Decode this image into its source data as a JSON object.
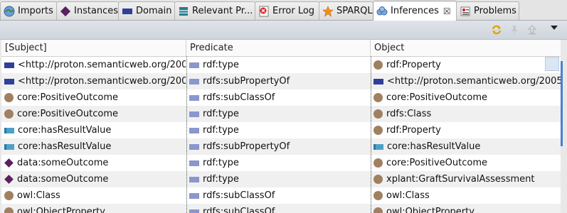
{
  "tabs": [
    {
      "label": "Imports",
      "icon": "imports-icon",
      "active": false
    },
    {
      "label": "Instances",
      "icon": "instances-icon",
      "active": false
    },
    {
      "label": "Domain",
      "icon": "domain-icon",
      "active": false
    },
    {
      "label": "Relevant Pr...",
      "icon": "relevant-properties-icon",
      "active": false
    },
    {
      "label": "Error Log",
      "icon": "error-log-icon",
      "active": false
    },
    {
      "label": "SPARQL",
      "icon": "sparql-icon",
      "active": false
    },
    {
      "label": "Inferences",
      "icon": "inferences-icon",
      "active": true,
      "close": "☒"
    },
    {
      "label": "Problems",
      "icon": "problems-icon",
      "active": false
    }
  ],
  "toolbar": {
    "buttons": [
      "refresh-icon",
      "pin-icon",
      "export-icon"
    ],
    "menu": "view-menu-icon"
  },
  "table": {
    "columns": [
      "[Subject]",
      "Predicate",
      "Object"
    ],
    "rows": [
      {
        "subject": "<http://proton.semanticweb.org/200",
        "subject_icon": "property",
        "predicate": "rdf:type",
        "object": "rdf:Property",
        "object_icon": "circle"
      },
      {
        "subject": "<http://proton.semanticweb.org/200",
        "subject_icon": "property",
        "predicate": "rdfs:subPropertyOf",
        "object": "<http://proton.semanticweb.org/2005,",
        "object_icon": "property"
      },
      {
        "subject": "core:PositiveOutcome",
        "subject_icon": "circle",
        "predicate": "rdfs:subClassOf",
        "object": "core:PositiveOutcome",
        "object_icon": "circle"
      },
      {
        "subject": "core:PositiveOutcome",
        "subject_icon": "circle",
        "predicate": "rdf:type",
        "object": "rdfs:Class",
        "object_icon": "circle"
      },
      {
        "subject": "core:hasResultValue",
        "subject_icon": "dprop",
        "predicate": "rdf:type",
        "object": "rdf:Property",
        "object_icon": "circle"
      },
      {
        "subject": "core:hasResultValue",
        "subject_icon": "dprop",
        "predicate": "rdfs:subPropertyOf",
        "object": "core:hasResultValue",
        "object_icon": "dprop"
      },
      {
        "subject": "data:someOutcome",
        "subject_icon": "diamond",
        "predicate": "rdf:type",
        "object": "core:PositiveOutcome",
        "object_icon": "circle"
      },
      {
        "subject": "data:someOutcome",
        "subject_icon": "diamond",
        "predicate": "rdf:type",
        "object": "xplant:GraftSurvivalAssessment",
        "object_icon": "circle"
      },
      {
        "subject": "owl:Class",
        "subject_icon": "circle",
        "predicate": "rdfs:subClassOf",
        "object": "owl:Class",
        "object_icon": "circle"
      },
      {
        "subject": "owl:ObjectProperty",
        "subject_icon": "circle",
        "predicate": "rdfs:subClassOf",
        "object": "owl:ObjectProperty",
        "object_icon": "circle"
      }
    ]
  }
}
